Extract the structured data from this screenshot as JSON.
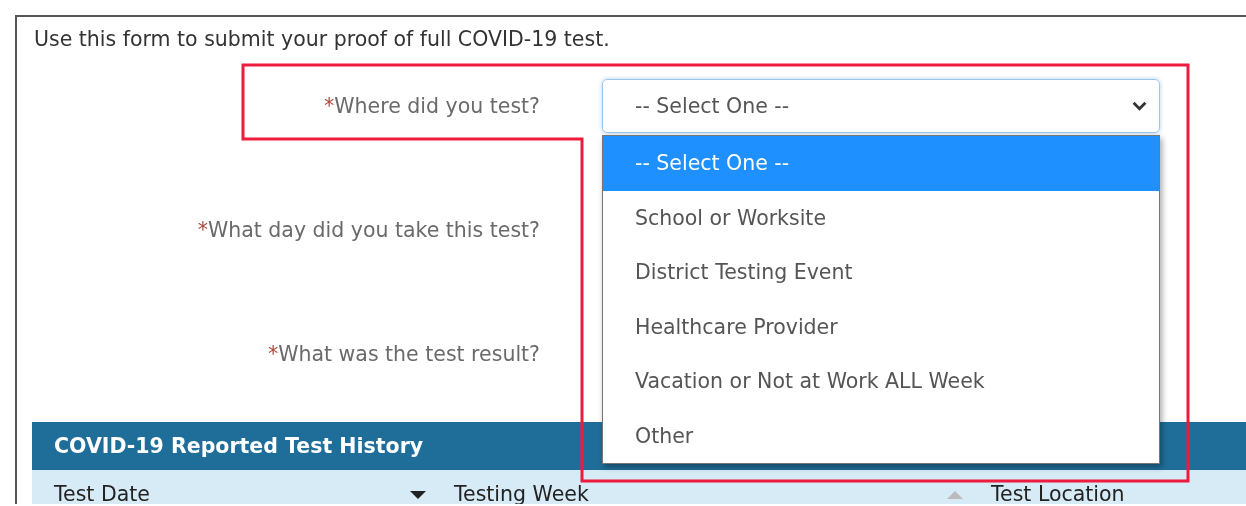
{
  "intro": "Use this form to submit your proof of full COVID-19 test.",
  "form": {
    "fields": [
      {
        "mark": "*",
        "label": "Where did you test?",
        "control": {
          "kind": "select",
          "value": "-- Select One --",
          "expanded": true,
          "options": [
            {
              "label": "-- Select One --",
              "selected": true
            },
            {
              "label": "School or Worksite",
              "selected": false
            },
            {
              "label": "District Testing Event",
              "selected": false
            },
            {
              "label": "Healthcare Provider",
              "selected": false
            },
            {
              "label": "Vacation or Not at Work ALL Week",
              "selected": false
            },
            {
              "label": "Other",
              "selected": false
            }
          ]
        }
      },
      {
        "mark": "*",
        "label": "What day did you take this test?"
      },
      {
        "mark": "*",
        "label": "What was the test result?"
      }
    ]
  },
  "table": {
    "title": "COVID-19 Reported Test History",
    "columns": [
      {
        "label": "Test Date",
        "kind": "sorted"
      },
      {
        "label": "Testing Week",
        "kind": "sortable"
      },
      {
        "label": "Test Location",
        "kind": "plain"
      }
    ]
  },
  "annotations": [
    {
      "kind": "outline"
    }
  ]
}
